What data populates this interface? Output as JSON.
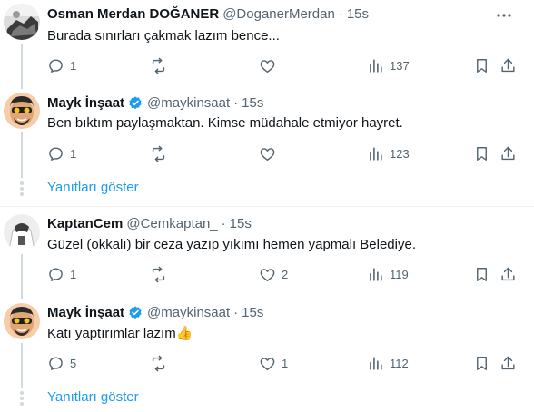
{
  "tweets": [
    {
      "name": "Osman Merdan DOĞANER",
      "handle": "@DoganerMerdan",
      "separator": "·",
      "time": "15s",
      "text": "Burada sınırları çakmak lazım bence...",
      "replies": "1",
      "retweets": "",
      "likes": "",
      "views": "137",
      "verified": false,
      "icon": "avatar-photo"
    },
    {
      "name": "Mayk İnşaat",
      "handle": "@maykinsaat",
      "separator": "·",
      "time": "15s",
      "text": "Ben bıktım paylaşmaktan. Kimse müdahale etmiyor hayret.",
      "replies": "1",
      "retweets": "",
      "likes": "",
      "views": "123",
      "verified": true,
      "icon": "avatar-cartoon"
    },
    {
      "name": "KaptanCem",
      "handle": "@Cemkaptan_",
      "separator": "·",
      "time": "15s",
      "text": "Güzel (okkalı) bir ceza yazıp yıkımı hemen yapmalı Belediye.",
      "replies": "1",
      "retweets": "",
      "likes": "2",
      "views": "119",
      "verified": false,
      "icon": "avatar-photo"
    },
    {
      "name": "Mayk İnşaat",
      "handle": "@maykinsaat",
      "separator": "·",
      "time": "15s",
      "text": "Katı yaptırımlar lazım",
      "emoji": "👍",
      "replies": "5",
      "retweets": "",
      "likes": "1",
      "views": "112",
      "verified": true,
      "icon": "avatar-cartoon"
    }
  ],
  "show_replies_label": "Yanıtları göster",
  "colors": {
    "accent": "#1d9bf0",
    "muted": "#536471",
    "thread_line": "#cfd9de",
    "divider": "#eff3f4"
  }
}
